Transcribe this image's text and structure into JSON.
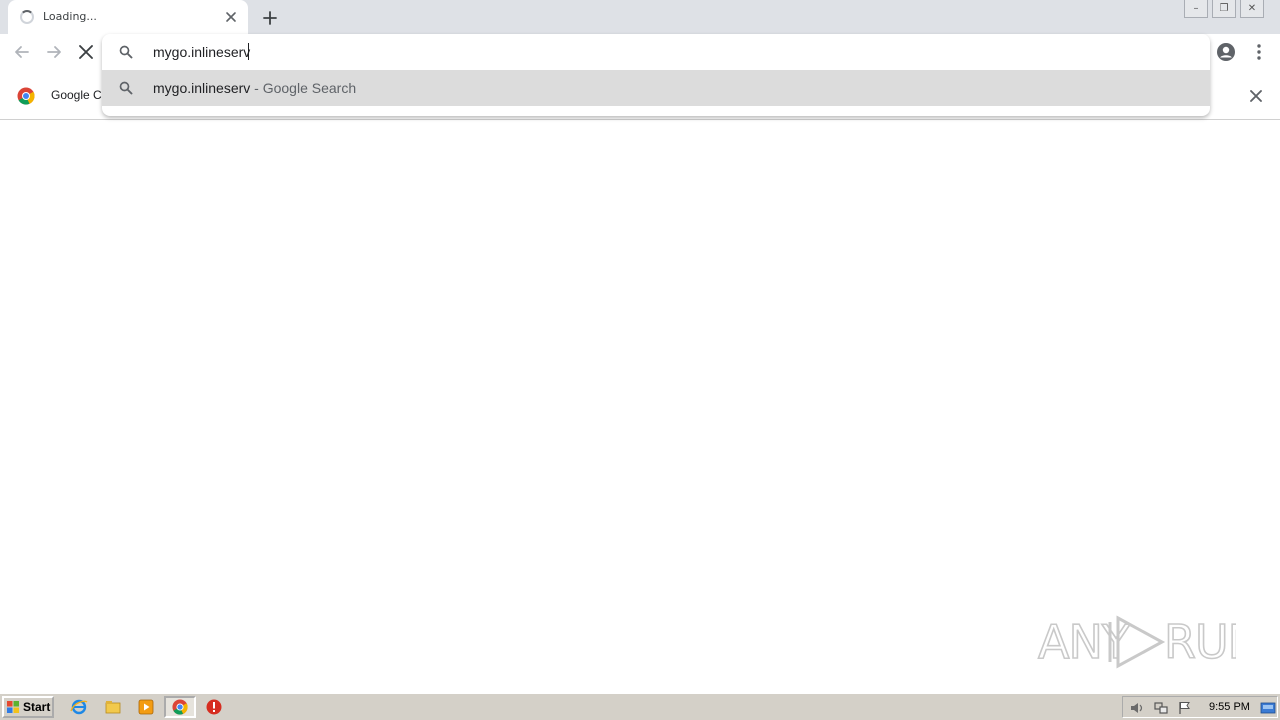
{
  "tab": {
    "title": "Loading...",
    "close_label": "close tab"
  },
  "window_controls": {
    "minimize": "–",
    "maximize": "❐",
    "close": "✕"
  },
  "omnibox": {
    "value": "mygo.inlineserv",
    "suggestion": {
      "query": "mygo.inlineserv",
      "suffix": " - Google Search"
    }
  },
  "infobar": {
    "text": "Google Cl"
  },
  "watermark": {
    "text": "ANY RUN"
  },
  "taskbar": {
    "start_label": "Start",
    "clock": "9:55 PM"
  },
  "colors": {
    "tabstrip": "#dee1e6",
    "suggestion_highlight": "#dcdcdc",
    "icon_gray": "#5f6368",
    "taskbar": "#d4d0c8"
  }
}
